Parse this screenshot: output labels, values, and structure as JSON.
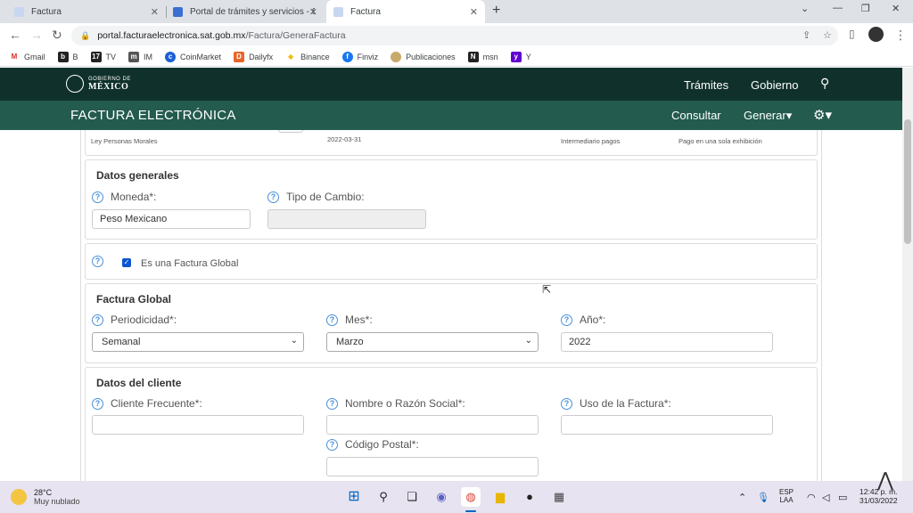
{
  "browser": {
    "tabs": [
      {
        "title": "Factura"
      },
      {
        "title": "Portal de trámites y servicios - SA"
      },
      {
        "title": "Factura"
      }
    ],
    "url_domain": "portal.facturaelectronica.sat.gob.mx",
    "url_path": "/Factura/GeneraFactura",
    "bookmarks": [
      "Gmail",
      "B",
      "TV",
      "IM",
      "CoinMarket",
      "Dailyfx",
      "Binance",
      "Finviz",
      "Publicaciones",
      "msn",
      "Y"
    ]
  },
  "header": {
    "logo_line1": "GOBIERNO DE",
    "logo_line2": "MÉXICO",
    "nav_tramites": "Trámites",
    "nav_gobierno": "Gobierno",
    "app_title": "FACTURA ELECTRÓNICA",
    "consultar": "Consultar",
    "generar": "Generar▾"
  },
  "prev_row": {
    "regimen": "Ley Personas Morales",
    "fecha": "2022-03-31",
    "metodo": "Intermediario pagos",
    "forma": "Pago en una sola exhibición"
  },
  "datos_generales": {
    "title": "Datos generales",
    "moneda_label": "Moneda*:",
    "moneda_value": "Peso Mexicano",
    "tipo_cambio_label": "Tipo de Cambio:",
    "tipo_cambio_value": ""
  },
  "factura_global_check": {
    "label": "Es una Factura Global",
    "checked": true
  },
  "factura_global": {
    "title": "Factura Global",
    "periodicidad_label": "Periodicidad*:",
    "periodicidad_value": "Semanal",
    "mes_label": "Mes*:",
    "mes_value": "Marzo",
    "anio_label": "Año*:",
    "anio_value": "2022"
  },
  "datos_cliente": {
    "title": "Datos del cliente",
    "cliente_label": "Cliente Frecuente*:",
    "razon_label": "Nombre o Razón Social*:",
    "uso_label": "Uso de la Factura*:",
    "cp_label": "Código Postal*:"
  },
  "taskbar": {
    "temperature": "28°C",
    "weather": "Muy nublado",
    "lang1": "ESP",
    "lang2": "LAA",
    "time": "12:42 p. m.",
    "date": "31/03/2022"
  },
  "colors": {
    "gov_dark": "#10312b",
    "gov_green": "#235b4e",
    "help_blue": "#4a90d9"
  }
}
